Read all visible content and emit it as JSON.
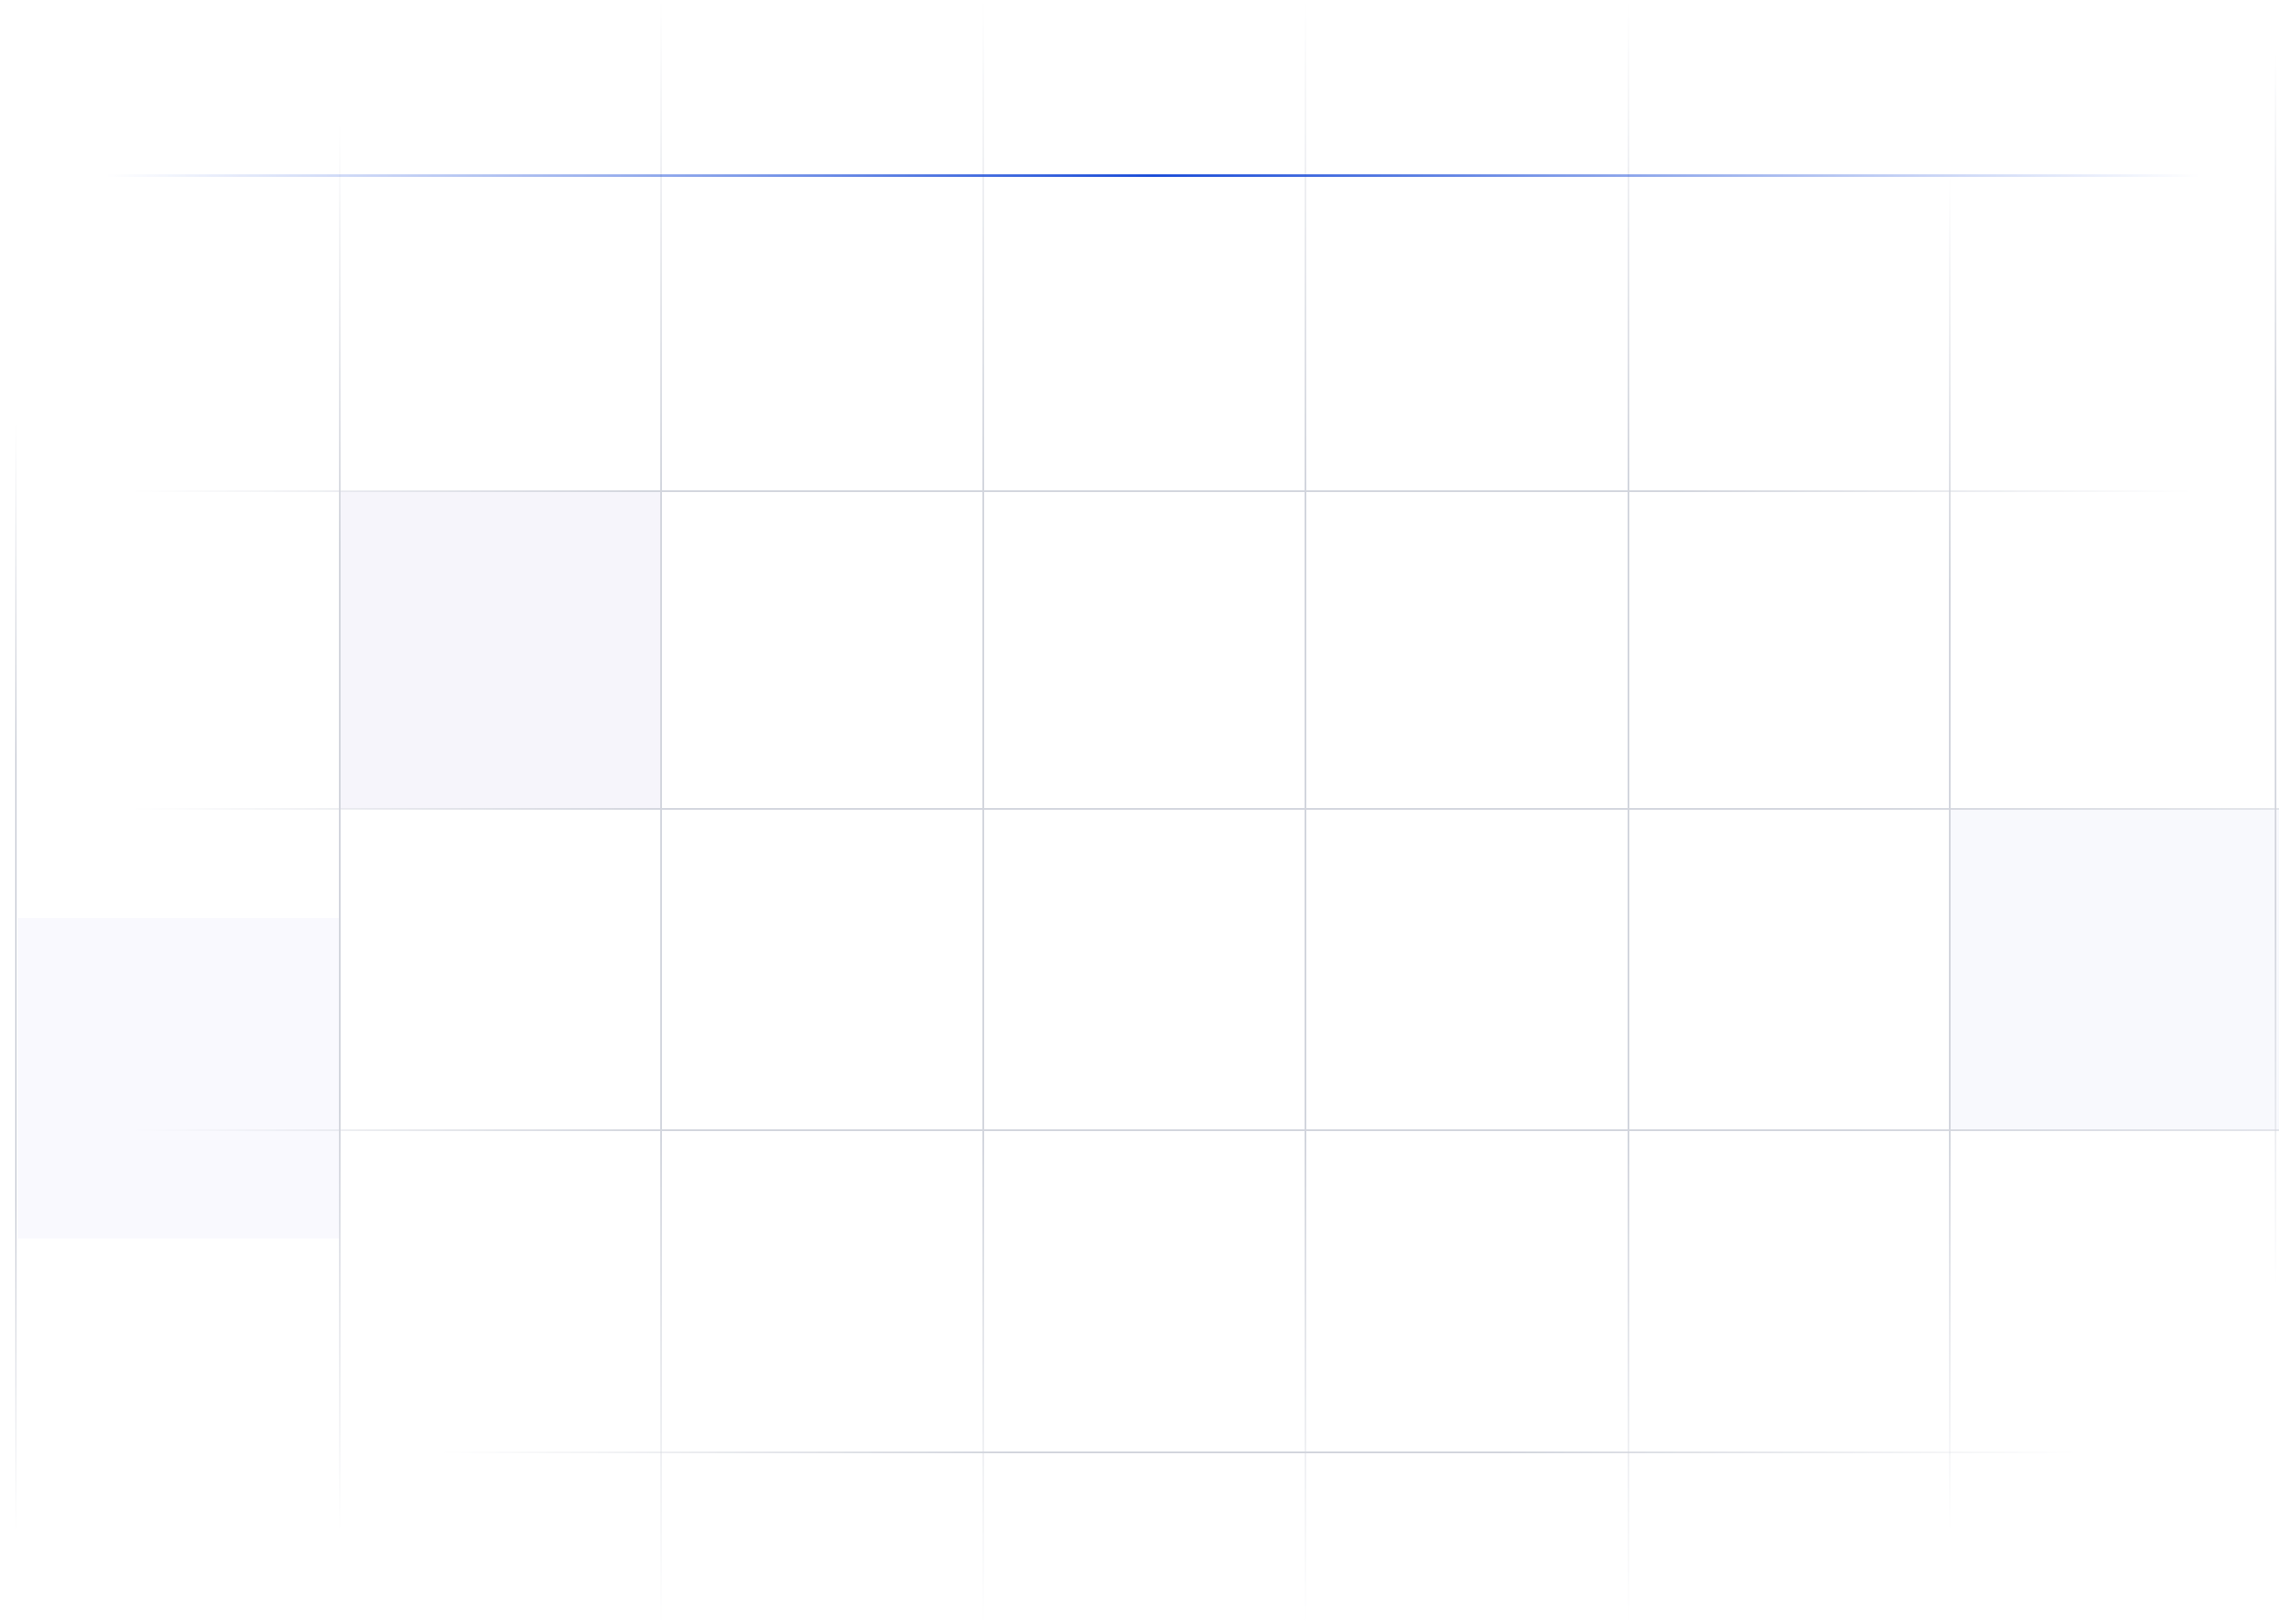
{
  "grid": {
    "columns": 7,
    "rows": 5,
    "line_color": "#d2d5dd",
    "accent_color": "#1d4ed8",
    "highlighted_cells": [
      {
        "name": "cell-tint-lavender",
        "col": 1,
        "row": 1,
        "color": "#f6f5fb"
      },
      {
        "name": "cell-tint-blue",
        "col": 6,
        "row": 2,
        "color": "#f8f9fd"
      },
      {
        "name": "cell-tint-lilac",
        "col": 0,
        "row": 2.33,
        "color": "#f9f9fe"
      }
    ]
  }
}
